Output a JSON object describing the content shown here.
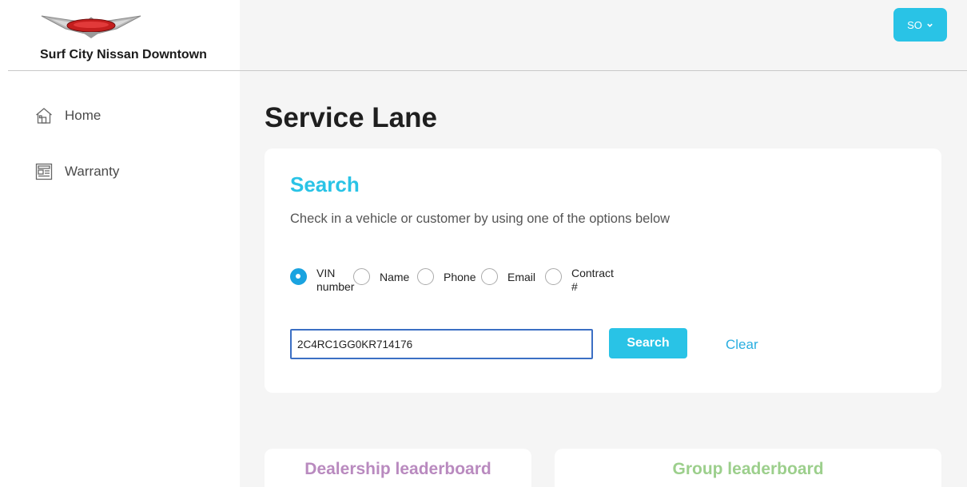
{
  "brand": {
    "name": "Surf City Nissan Downtown",
    "logo_icon": "cars-movie-logo"
  },
  "nav": [
    {
      "label": "Home",
      "icon": "home-icon"
    },
    {
      "label": "Warranty",
      "icon": "document-icon"
    }
  ],
  "user_menu": {
    "initials": "SO",
    "icon": "chevron-down-icon"
  },
  "page_title": "Service Lane",
  "search": {
    "title": "Search",
    "subtitle": "Check in a vehicle or customer by using one of the options below",
    "options": [
      {
        "label": "VIN number",
        "checked": true
      },
      {
        "label": "Name",
        "checked": false
      },
      {
        "label": "Phone",
        "checked": false
      },
      {
        "label": "Email",
        "checked": false
      },
      {
        "label": "Contract #",
        "checked": false
      }
    ],
    "input_value": "2C4RC1GG0KR714176",
    "search_label": "Search",
    "clear_label": "Clear"
  },
  "leaderboards": {
    "dealership": "Dealership leaderboard",
    "group": "Group leaderboard"
  },
  "colors": {
    "accent": "#29c3e6",
    "dealership": "#b98abf",
    "group": "#9ccf8c"
  }
}
